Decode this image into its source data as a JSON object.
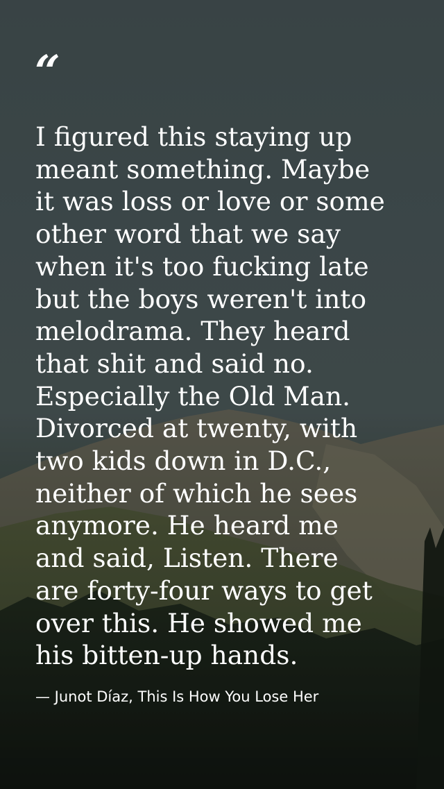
{
  "quote": {
    "mark": "“",
    "lines": [
      "I figured this staying up",
      "meant something. Maybe",
      "it was loss or love or some",
      "other word that we say",
      "when it's too fucking late",
      "but the boys weren't into",
      "melodrama. They heard",
      "that shit and said no.",
      "Especially the Old Man.",
      "Divorced at twenty, with",
      "two kids down in D.C.,",
      "neither of which he sees",
      "anymore. He heard me",
      "and said, Listen. There",
      "are forty-four ways to get",
      "over this. He showed me",
      "his bitten-up hands."
    ]
  },
  "attribution": "— Junot Díaz, This Is How You Lose Her",
  "colors": {
    "text": "#ffffff",
    "sky": "#475456",
    "mountain": "#5c5a4a",
    "forest": "#1e2a1a"
  },
  "background": {
    "icon": "mountain-landscape-photo"
  }
}
